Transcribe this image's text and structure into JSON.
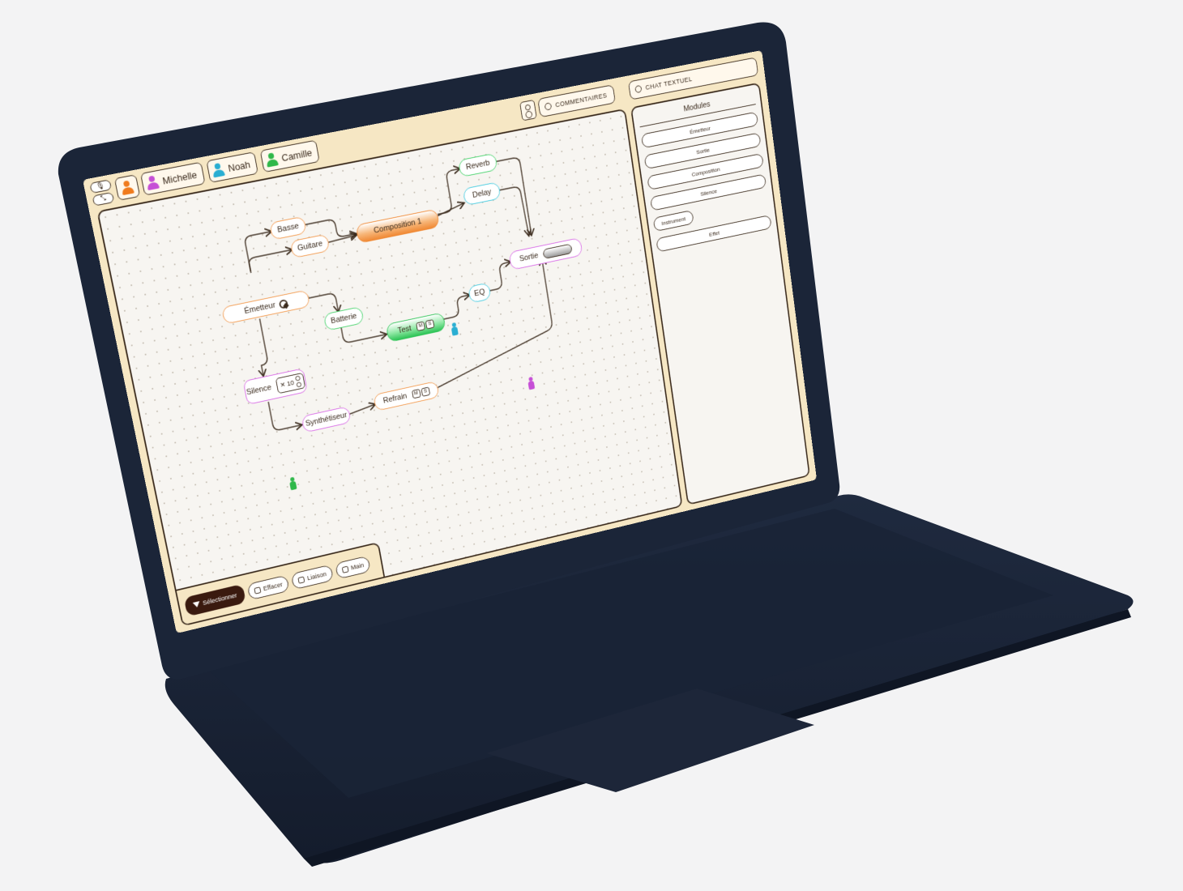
{
  "colors": {
    "bezel": "#1b2538",
    "frame": "#f6e7c4",
    "ink": "#3a2a1c",
    "orange": "#f39a4e",
    "green": "#46d36b",
    "cyan": "#43cbe0",
    "magenta": "#d869e6",
    "toolbar_active": "#3a1a0f"
  },
  "topbar": {
    "users": [
      {
        "name": "Michelle",
        "color": "#c64fd6"
      },
      {
        "name": "Noah",
        "color": "#2aaed2"
      },
      {
        "name": "Camille",
        "color": "#2fb84a"
      }
    ],
    "self_color": "#f07b1d",
    "comments_label": "COMMENTAIRES",
    "chat_label": "CHAT TEXTUEL"
  },
  "nodes": {
    "basse": "Basse",
    "guitare": "Guitare",
    "composition1": "Composition 1",
    "reverb": "Reverb",
    "delay": "Delay",
    "emetteur": "Émetteur",
    "batterie": "Batterie",
    "test": "Test",
    "eq": "EQ",
    "sortie": "Sortie",
    "silence": "Silence",
    "silence_repeat": "10",
    "synthetiseur": "Synthétiseur",
    "refrain": "Refrain",
    "mute": "M",
    "solo": "S"
  },
  "toolbar": {
    "select": "Sélectionner",
    "erase": "Effacer",
    "link": "Liaison",
    "hand": "Main"
  },
  "panel": {
    "title": "Modules",
    "items": [
      "Émetteur",
      "Sortie",
      "Composition",
      "Silence",
      "Instrument",
      "Effet"
    ]
  }
}
